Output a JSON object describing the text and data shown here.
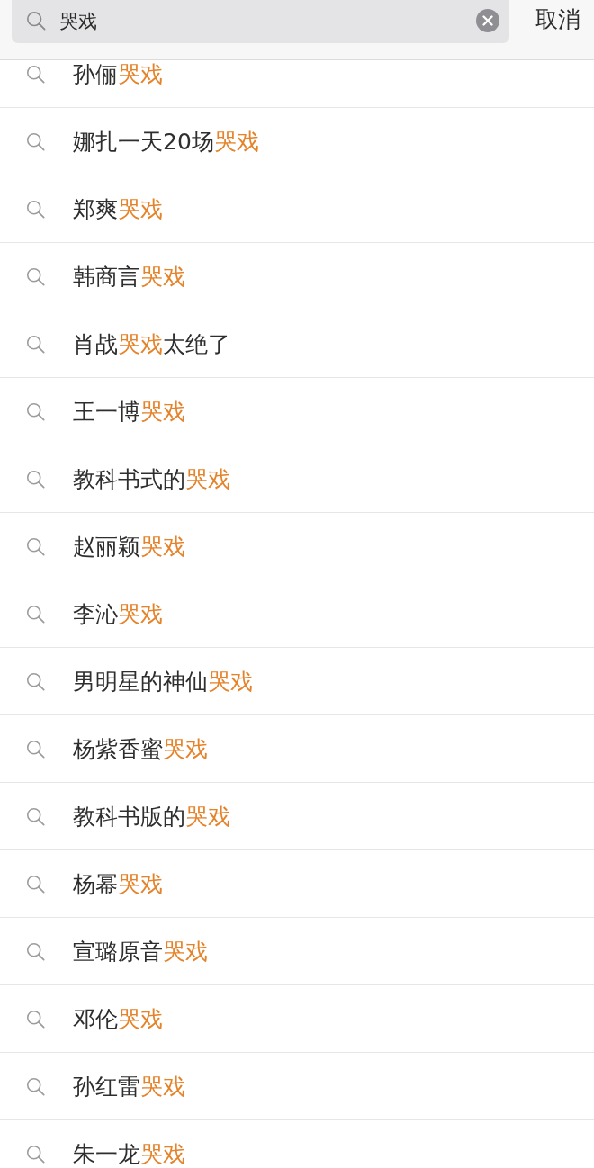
{
  "search": {
    "value": "哭戏",
    "cancel_button": "取消"
  },
  "suggestions": [
    {
      "segments": [
        {
          "text": "孙俪",
          "highlighted": false
        },
        {
          "text": "哭戏",
          "highlighted": true
        }
      ]
    },
    {
      "segments": [
        {
          "text": "娜扎一天20场",
          "highlighted": false
        },
        {
          "text": "哭戏",
          "highlighted": true
        }
      ]
    },
    {
      "segments": [
        {
          "text": "郑爽",
          "highlighted": false
        },
        {
          "text": "哭戏",
          "highlighted": true
        }
      ]
    },
    {
      "segments": [
        {
          "text": "韩商言",
          "highlighted": false
        },
        {
          "text": "哭戏",
          "highlighted": true
        }
      ]
    },
    {
      "segments": [
        {
          "text": "肖战",
          "highlighted": false
        },
        {
          "text": "哭戏",
          "highlighted": true
        },
        {
          "text": "太绝了",
          "highlighted": false
        }
      ]
    },
    {
      "segments": [
        {
          "text": "王一博",
          "highlighted": false
        },
        {
          "text": "哭戏",
          "highlighted": true
        }
      ]
    },
    {
      "segments": [
        {
          "text": "教科书式的",
          "highlighted": false
        },
        {
          "text": "哭戏",
          "highlighted": true
        }
      ]
    },
    {
      "segments": [
        {
          "text": "赵丽颖",
          "highlighted": false
        },
        {
          "text": "哭戏",
          "highlighted": true
        }
      ]
    },
    {
      "segments": [
        {
          "text": "李沁",
          "highlighted": false
        },
        {
          "text": "哭戏",
          "highlighted": true
        }
      ]
    },
    {
      "segments": [
        {
          "text": "男明星的神仙",
          "highlighted": false
        },
        {
          "text": "哭戏",
          "highlighted": true
        }
      ]
    },
    {
      "segments": [
        {
          "text": "杨紫香蜜",
          "highlighted": false
        },
        {
          "text": "哭戏",
          "highlighted": true
        }
      ]
    },
    {
      "segments": [
        {
          "text": "教科书版的",
          "highlighted": false
        },
        {
          "text": "哭戏",
          "highlighted": true
        }
      ]
    },
    {
      "segments": [
        {
          "text": "杨幂",
          "highlighted": false
        },
        {
          "text": "哭戏",
          "highlighted": true
        }
      ]
    },
    {
      "segments": [
        {
          "text": "宣璐原音",
          "highlighted": false
        },
        {
          "text": "哭戏",
          "highlighted": true
        }
      ]
    },
    {
      "segments": [
        {
          "text": "邓伦",
          "highlighted": false
        },
        {
          "text": "哭戏",
          "highlighted": true
        }
      ]
    },
    {
      "segments": [
        {
          "text": "孙红雷",
          "highlighted": false
        },
        {
          "text": "哭戏",
          "highlighted": true
        }
      ]
    },
    {
      "segments": [
        {
          "text": "朱一龙",
          "highlighted": false
        },
        {
          "text": "哭戏",
          "highlighted": true
        }
      ]
    }
  ]
}
